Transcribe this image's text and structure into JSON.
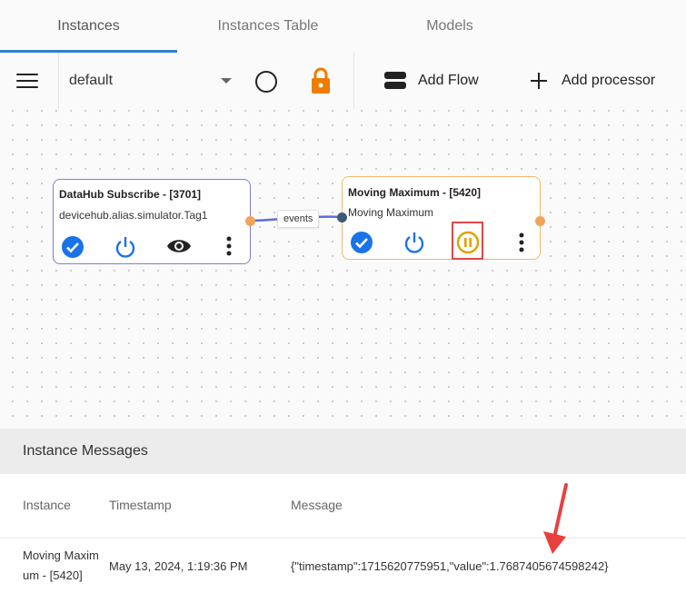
{
  "tabs": [
    {
      "label": "Instances",
      "active": true
    },
    {
      "label": "Instances Table",
      "active": false
    },
    {
      "label": "Models",
      "active": false
    }
  ],
  "toolbar": {
    "flow_select_value": "default",
    "add_flow_label": "Add Flow",
    "add_processor_label": "Add processor",
    "icons": [
      "menu-icon",
      "circle-icon",
      "lock-icon",
      "flow-icon",
      "plus-icon"
    ],
    "lock_color": "#ef7b00"
  },
  "canvas": {
    "nodes": [
      {
        "title": "DataHub Subscribe - [3701]",
        "subtitle": "devicehub.alias.simulator.Tag1",
        "border_color": "#7d7fd8",
        "actions": [
          "check-circle-icon",
          "power-icon",
          "eye-icon",
          "more-vert-icon"
        ]
      },
      {
        "title": "Moving Maximum - [5420]",
        "subtitle": "Moving Maximum",
        "border_color": "#f3b86a",
        "actions": [
          "check-circle-icon",
          "power-icon",
          "pause-circle-icon",
          "more-vert-icon"
        ]
      }
    ],
    "edge_label": "events",
    "accent": "#1a73e8",
    "pause_color": "#e0a100"
  },
  "messages": {
    "title": "Instance Messages",
    "columns": [
      "Instance",
      "Timestamp",
      "Message"
    ],
    "rows": [
      {
        "instance_line1": "Moving Maxim",
        "instance_line2": "um - [5420]",
        "timestamp": "May 13, 2024, 1:19:36 PM",
        "message": "{\"timestamp\":1715620775951,\"value\":1.7687405674598242}"
      }
    ]
  }
}
